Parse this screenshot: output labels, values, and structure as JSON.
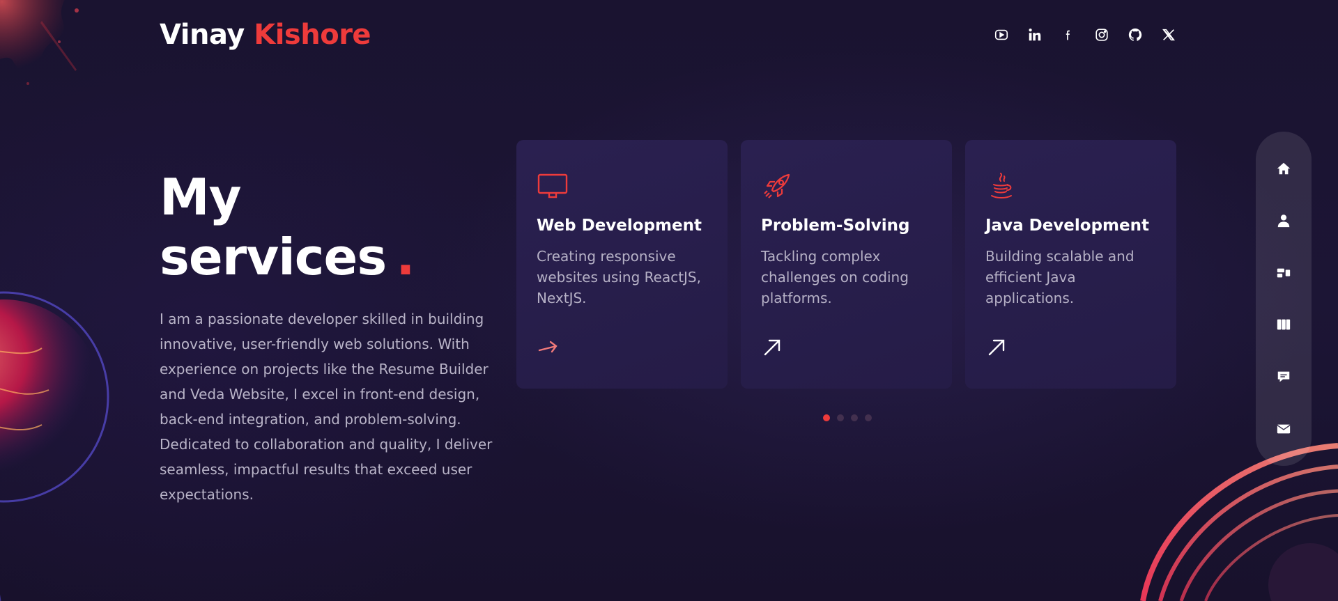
{
  "header": {
    "logo_first": "Vinay",
    "logo_last": "Kishore",
    "socials": [
      {
        "icon": "youtube-icon"
      },
      {
        "icon": "linkedin-icon"
      },
      {
        "icon": "facebook-icon"
      },
      {
        "icon": "instagram-icon"
      },
      {
        "icon": "github-icon"
      },
      {
        "icon": "x-twitter-icon"
      }
    ]
  },
  "intro": {
    "title": "My services",
    "title_dot": ".",
    "description": "I am a passionate developer skilled in building innovative, user-friendly web solutions. With experience on projects like the Resume Builder and Veda Website, I excel in front-end design, back-end integration, and problem-solving. Dedicated to collaboration and quality, I deliver seamless, impactful results that exceed user expectations."
  },
  "services": [
    {
      "icon": "monitor-icon",
      "title": "Web Development",
      "description": "Creating responsive websites using ReactJS, NextJS."
    },
    {
      "icon": "rocket-icon",
      "title": "Problem-Solving",
      "description": "Tackling complex challenges on coding platforms."
    },
    {
      "icon": "java-icon",
      "title": "Java Development",
      "description": "Building scalable and efficient Java applications."
    }
  ],
  "carousel": {
    "pages": 4,
    "active_index": 0
  },
  "sidenav": [
    {
      "icon": "home-icon"
    },
    {
      "icon": "user-icon"
    },
    {
      "icon": "services-icon"
    },
    {
      "icon": "projects-icon"
    },
    {
      "icon": "chat-icon"
    },
    {
      "icon": "mail-icon"
    }
  ],
  "colors": {
    "accent": "#ee3b3b",
    "background": "#1b1430",
    "card": "#2a2050"
  }
}
